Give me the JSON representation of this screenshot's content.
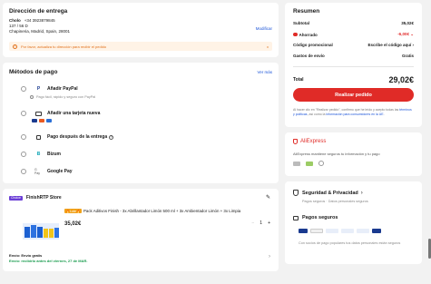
{
  "delivery": {
    "title": "Dirección de entrega",
    "name": "Cholo",
    "phone": "+34 3923879845",
    "line1": "137 / 56 D",
    "line2": "Chapineria, Madrid, Spain, 28001",
    "modify": "Modificar",
    "warning": "Por favor, actualiza tu dirección para recibir el pedido",
    "close_icon": "x"
  },
  "payment": {
    "title": "Métodos de pago",
    "more": "Ver más",
    "paypal_label": "Añadir PayPal",
    "paypal_sub": "Pago fácil, rápido y seguro con PayPal",
    "card_label": "Añadir una tarjeta nueva",
    "later_label": "Pago después de la entrega",
    "bizum_label": "Bizum",
    "gpay_label": "Google Pay",
    "gpay_icon_text": "G Pay"
  },
  "store": {
    "badge": "Choice",
    "name": "FinishRTP Store",
    "product_tag": "🔥Lote🔥",
    "product_title": "Pack Aditivos Finish - 3x Abrillantador Limón 500 ml + 3x Ambientador Limón + 3x Limpia",
    "price": "35,02€",
    "qty": "1",
    "minus": "−",
    "plus": "+",
    "ship_free": "Envío: Envío gratis",
    "ship_date": "Envío: recibirlo antes del viernes, 27 de MAR."
  },
  "summary": {
    "title": "Resumen",
    "subtotal_label": "Subtotal",
    "subtotal_value": "35,02€",
    "saved_label": "Ahorrado",
    "saved_value": "-6,00€",
    "promo_label": "Código promocional",
    "promo_value": "Escribe el código aquí",
    "shipping_label": "Gastos de envío",
    "shipping_value": "Gratis",
    "total_label": "Total",
    "total_value": "29,02€",
    "order_button": "Realizar pedido",
    "terms_1": "Al hacer clic en \"Realizar pedido\", confirmo que he leído y acepto todas las ",
    "terms_link1": "términos y políticas",
    "terms_2": ", así como la ",
    "terms_link2": "información para consumidores en la UE",
    "terms_3": "."
  },
  "ali": {
    "logo": "AliExpress",
    "text": "AliExpress mantiene seguros tu información y tu pago"
  },
  "security": {
    "title": "Seguridad & Privacidad",
    "sub": "Pagos seguros · Datos personales seguros",
    "pay_title": "Pagos seguros",
    "pay_text": "Con socios de pago populares tus datos personales están seguros"
  },
  "colors": {
    "accent_red": "#e02b27",
    "link_blue": "#1a53d8",
    "background": "#f2f2f2"
  }
}
